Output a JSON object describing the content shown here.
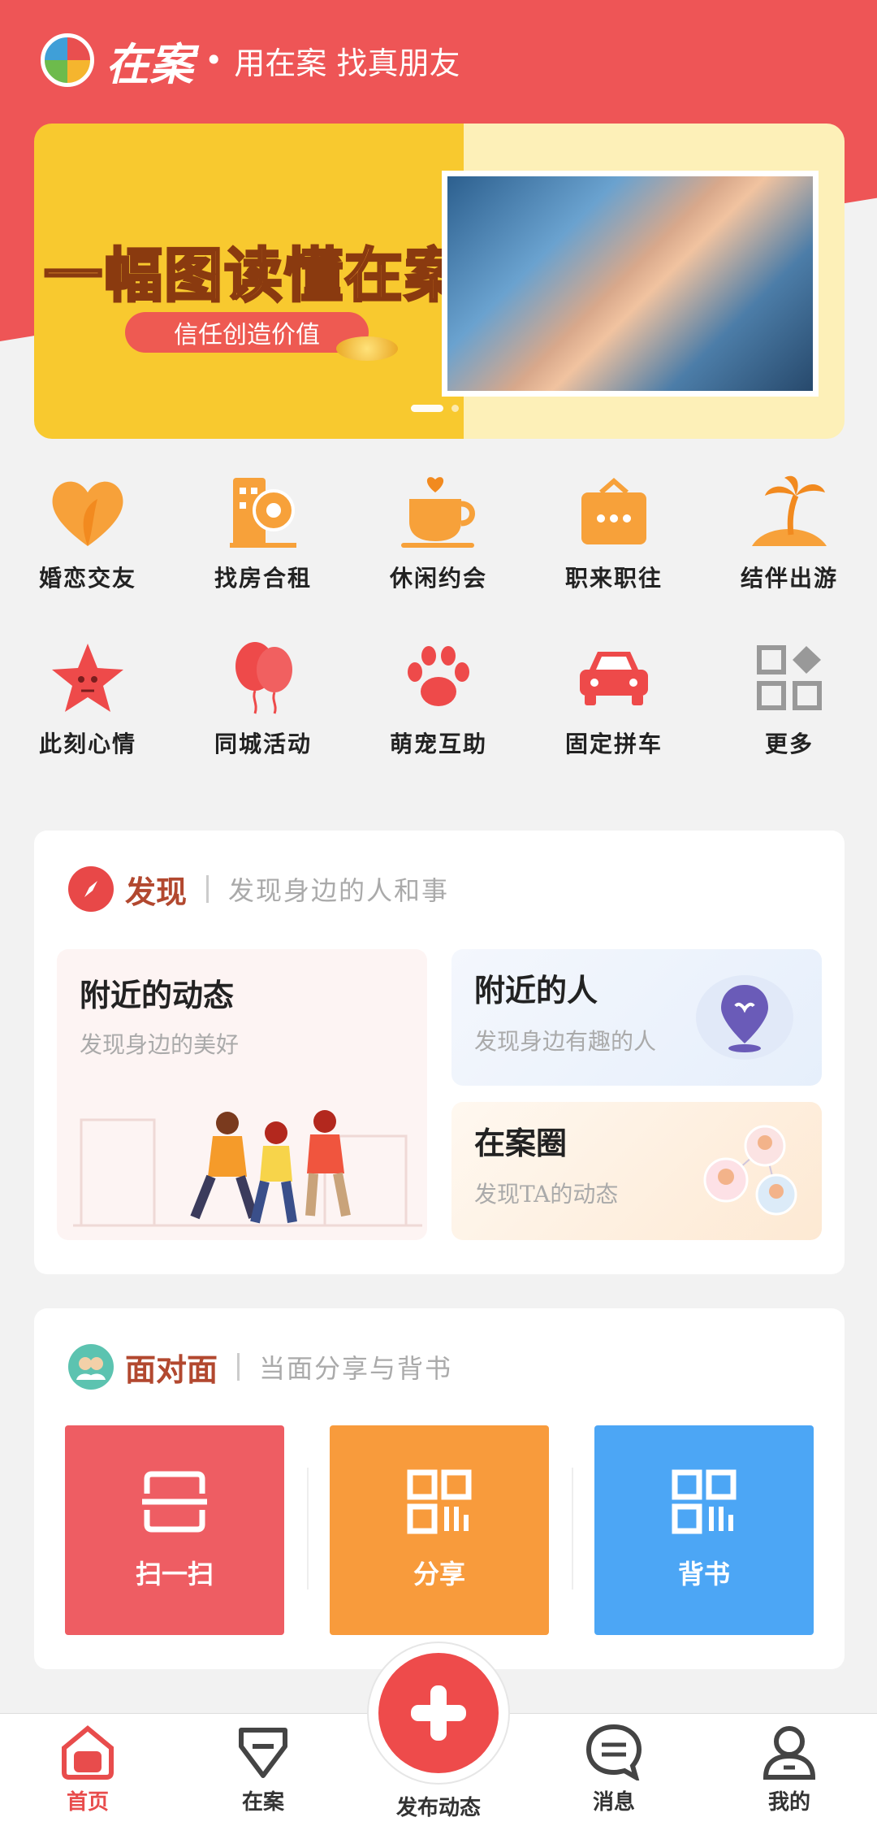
{
  "header": {
    "logo_text": "在案",
    "bullet": "•",
    "slogan": "用在案 找真朋友"
  },
  "banner": {
    "title": "一幅图读懂在案",
    "pill": "信任创造价值"
  },
  "categories": [
    {
      "label": "婚恋交友",
      "icon": "heart-icon"
    },
    {
      "label": "找房合租",
      "icon": "building-pin-icon"
    },
    {
      "label": "休闲约会",
      "icon": "coffee-cup-icon"
    },
    {
      "label": "职来职往",
      "icon": "briefcase-icon"
    },
    {
      "label": "结伴出游",
      "icon": "palm-tree-icon"
    },
    {
      "label": "此刻心情",
      "icon": "star-face-icon"
    },
    {
      "label": "同城活动",
      "icon": "balloons-icon"
    },
    {
      "label": "萌宠互助",
      "icon": "paw-icon"
    },
    {
      "label": "固定拼车",
      "icon": "car-icon"
    },
    {
      "label": "更多",
      "icon": "grid-more-icon"
    }
  ],
  "discover": {
    "title": "发现",
    "subtitle": "发现身边的人和事",
    "cards": [
      {
        "title": "附近的动态",
        "subtitle": "发现身边的美好"
      },
      {
        "title": "附近的人",
        "subtitle": "发现身边有趣的人"
      },
      {
        "title": "在案圈",
        "subtitle": "发现TA的动态"
      }
    ]
  },
  "face_to_face": {
    "title": "面对面",
    "subtitle": "当面分享与背书",
    "buttons": [
      {
        "label": "扫一扫",
        "color": "#ee5d63"
      },
      {
        "label": "分享",
        "color": "#f89b3c"
      },
      {
        "label": "背书",
        "color": "#4ca6f5"
      }
    ]
  },
  "tabbar": {
    "items": [
      {
        "label": "首页",
        "icon": "home-icon",
        "active": true
      },
      {
        "label": "在案",
        "icon": "badge-icon"
      },
      {
        "label": "发布动态",
        "icon": "plus-icon"
      },
      {
        "label": "消息",
        "icon": "message-icon"
      },
      {
        "label": "我的",
        "icon": "user-icon"
      }
    ]
  },
  "colors": {
    "brand_red": "#ee5556",
    "category_orange": "#f7a13a",
    "category_red": "#ee4a4a",
    "category_gray": "#999999"
  }
}
